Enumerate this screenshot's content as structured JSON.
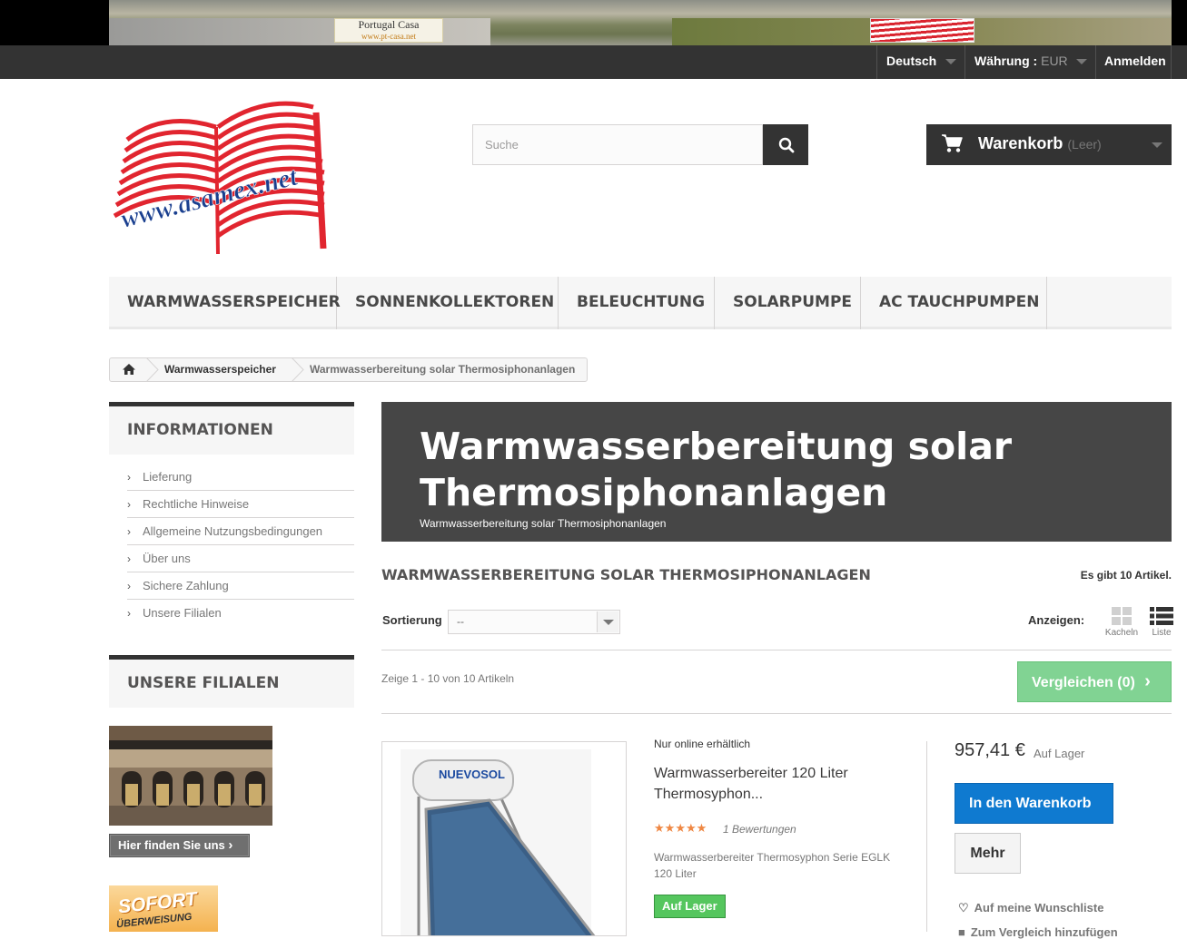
{
  "banner": {
    "logo1_title": "Portugal Casa",
    "logo1_sub": "www.pt-casa.net",
    "logo2_text": "www.asamex.net"
  },
  "topnav": {
    "language": "Deutsch",
    "currency_label": "Währung :",
    "currency_value": "EUR",
    "login": "Anmelden"
  },
  "header": {
    "logo_text": "www.asamex.net",
    "search_placeholder": "Suche",
    "cart_label": "Warenkorb",
    "cart_status": "(Leer)"
  },
  "menu": [
    "WARMWASSERSPEICHER",
    "SONNENKOLLEKTOREN",
    "BELEUCHTUNG",
    "SOLARPUMPE",
    "AC TAUCHPUMPEN"
  ],
  "breadcrumb": {
    "level1": "Warmwasserspeicher",
    "current": "Warmwasserbereitung solar Thermosiphonanlagen"
  },
  "sidebar": {
    "info_title": "INFORMATIONEN",
    "info_items": [
      "Lieferung",
      "Rechtliche Hinweise",
      "Allgemeine Nutzungsbedingungen",
      "Über uns",
      "Sichere Zahlung",
      "Unsere Filialen"
    ],
    "stores_title": "UNSERE FILIALEN",
    "stores_button": "Hier finden Sie uns",
    "sofort_line1": "SOFORT",
    "sofort_line2": "ÜBERWEISUNG"
  },
  "category": {
    "title": "Warmwasserbereitung solar Thermosiphonanlagen",
    "subtitle": "Warmwasserbereitung solar Thermosiphonanlagen",
    "heading": "WARMWASSERBEREITUNG SOLAR THERMOSIPHONANLAGEN",
    "count": "Es gibt 10 Artikel."
  },
  "toolbar": {
    "sort_label": "Sortierung",
    "sort_value": "--",
    "view_label": "Anzeigen:",
    "view_grid": "Kacheln",
    "view_list": "Liste",
    "showing": "Zeige 1 - 10 von 10 Artikeln",
    "compare": "Vergleichen (0)"
  },
  "product": {
    "online_only": "Nur online erhältlich",
    "name": "Warmwasserbereiter 120 Liter Thermosyphon...",
    "rating": 5,
    "reviews": "1 Bewertungen",
    "description": "Warmwasserbereiter Thermosyphon Serie EGLK 120 Liter",
    "stock": "Auf Lager",
    "price": "957,41 €",
    "availability": "Auf Lager",
    "add_to_cart": "In den Warenkorb",
    "more": "Mehr",
    "wishlist": "Auf meine Wunschliste",
    "compare_link": "Zum Vergleich hinzufügen",
    "brand_text": "NUEVOSOL"
  },
  "colors": {
    "dark": "#333333",
    "accent_green": "#55c65e",
    "cart_blue": "#0f7ad0",
    "compare_green": "#7bd18e",
    "star_orange": "#ef8743"
  }
}
